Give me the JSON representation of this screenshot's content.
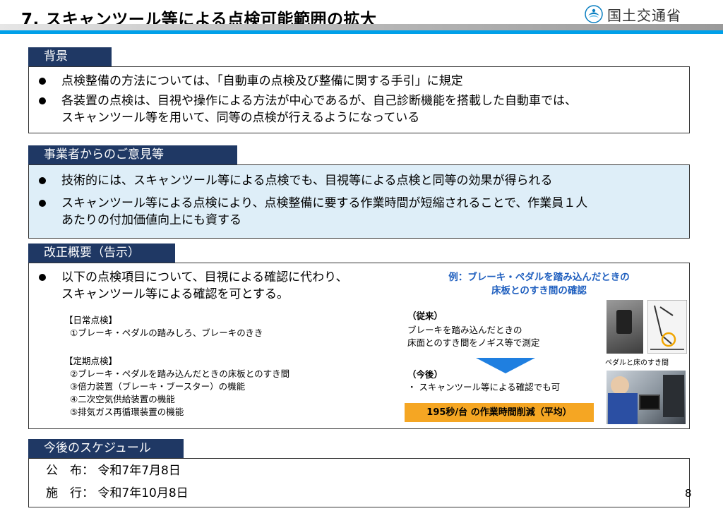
{
  "title": "7. スキャンツール等による点検可能範囲の拡大",
  "logo": {
    "text": "国土交通省",
    "icon": "mlit-logo-icon"
  },
  "background": {
    "label": "背景",
    "bullets": [
      "点検整備の方法については、「自動車の点検及び整備に関する手引」に規定",
      "各装置の点検は、目視や操作による方法が中心であるが、自己診断機能を搭載した自動車では、",
      "スキャンツール等を用いて、同等の点検が行えるようになっている"
    ]
  },
  "opinions": {
    "label": "事業者からのご意見等",
    "bullets": [
      "技術的には、スキャンツール等による点検でも、目視等による点検と同等の効果が得られる",
      "スキャンツール等による点検により、点検整備に要する作業時間が短縮されることで、作業員１人",
      "あたりの付加価値向上にも資する"
    ]
  },
  "revision": {
    "label": "改正概要（告示）",
    "bullet_line1": "以下の点検項目について、目視による確認に代わり、",
    "bullet_line2": "スキャンツール等による確認を可とする。",
    "daily_heading": "【日常点検】",
    "daily_items": [
      "①ブレーキ・ペダルの踏みしろ、ブレーキのきき"
    ],
    "periodic_heading": "【定期点検】",
    "periodic_items": [
      "②ブレーキ・ペダルを踏み込んだときの床板とのすき間",
      "③倍力装置（ブレーキ・ブースター）の機能",
      "④二次空気供給装置の機能",
      "⑤排気ガス再循環装置の機能"
    ],
    "example_title_line1": "例：ブレーキ・ペダルを踏み込んだときの",
    "example_title_line2": "床板とのすき間の確認",
    "before_heading": "（従来）",
    "before_line1": "ブレーキを踏み込んだときの",
    "before_line2": "床面とのすき間をノギス等で測定",
    "after_heading": "（今後）",
    "after_line": "・ スキャンツール等による確認でも可",
    "reduction_badge": "195秒/台 の作業時間削減（平均）",
    "photo_caption": "ペダルと床のすき間"
  },
  "schedule": {
    "label": "今後のスケジュール",
    "promulgation_label": "公　布：",
    "promulgation_date": "令和7年7月8日",
    "enforcement_label": "施　行：",
    "enforcement_date": "令和7年10月8日"
  },
  "page_number": "8",
  "colors": {
    "label_bg": "#1f3864",
    "accent_blue": "#00a0e9",
    "example_title": "#1f5fbf",
    "badge_bg": "#f5a623",
    "arrow": "#1f7fe0",
    "opinions_bg": "#deeef8"
  }
}
